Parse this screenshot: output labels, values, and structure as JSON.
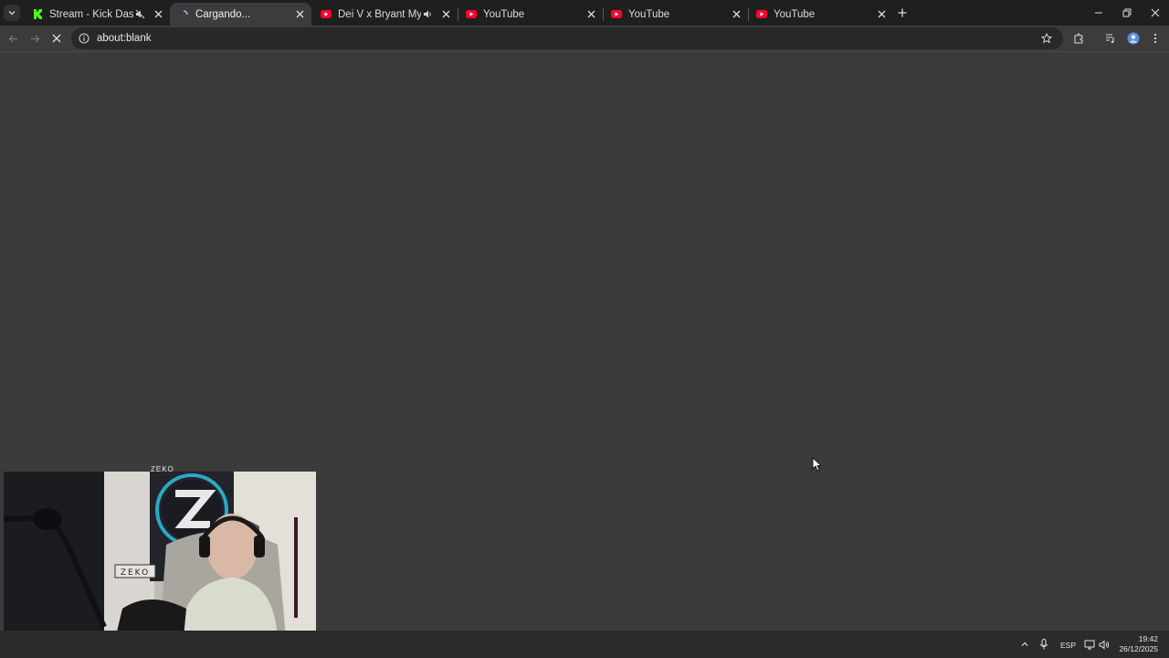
{
  "browser": {
    "tabs": [
      {
        "title": "Stream - Kick Dashboard",
        "favicon": "kick-logo-icon",
        "muted_icon": true,
        "active": false
      },
      {
        "title": "Cargando...",
        "favicon": "loading-spinner-icon",
        "muted_icon": false,
        "active": true
      },
      {
        "title": "Dei V x Bryant Myers - N@",
        "favicon": "youtube-icon",
        "audio_icon": true,
        "active": false
      },
      {
        "title": "YouTube",
        "favicon": "youtube-icon",
        "active": false
      },
      {
        "title": "YouTube",
        "favicon": "youtube-icon",
        "active": false
      },
      {
        "title": "YouTube",
        "favicon": "youtube-icon",
        "active": false
      }
    ],
    "address_bar": {
      "url": "about:blank"
    },
    "colors": {
      "kick_green": "#53fc18",
      "youtube_red": "#ff0033",
      "page_bg": "#3b3b3b"
    }
  },
  "webcam": {
    "label": "ZEKO",
    "sign_text": "ZEKO"
  },
  "taskbar": {
    "language": "ESP",
    "time": "19:42",
    "date": "26/12/2025"
  }
}
